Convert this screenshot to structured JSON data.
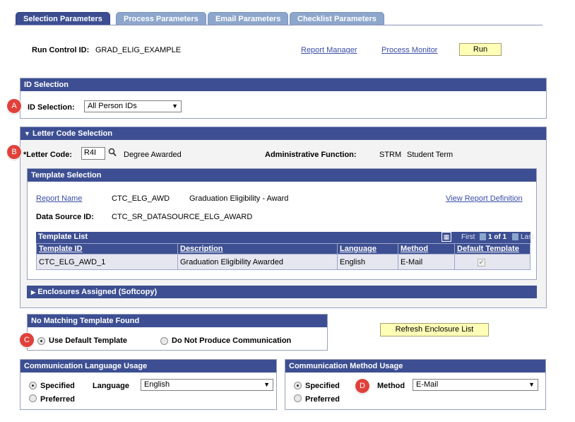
{
  "tabs": [
    {
      "label": "Selection Parameters",
      "active": true
    },
    {
      "label": "Process Parameters",
      "active": false
    },
    {
      "label": "Email Parameters",
      "active": false
    },
    {
      "label": "Checklist Parameters",
      "active": false
    }
  ],
  "header": {
    "run_control_label": "Run Control ID:",
    "run_control_value": "GRAD_ELIG_EXAMPLE",
    "report_manager": "Report Manager",
    "process_monitor": "Process Monitor",
    "run_button": "Run"
  },
  "id_selection": {
    "title": "ID Selection",
    "label": "ID Selection:",
    "value": "All Person IDs",
    "badge": "A"
  },
  "letter_code": {
    "title": "Letter Code Selection",
    "label": "*Letter Code:",
    "value": "R4I",
    "description": "Degree Awarded",
    "admin_func_label": "Administrative Function:",
    "admin_func_code": "STRM",
    "admin_func_desc": "Student Term",
    "badge": "B"
  },
  "template_selection": {
    "title": "Template Selection",
    "report_name_label": "Report Name",
    "report_name_code": "CTC_ELG_AWD",
    "report_name_desc": "Graduation Eligibility - Award",
    "view_report": "View Report Definition",
    "data_source_label": "Data Source ID:",
    "data_source_value": "CTC_SR_DATASOURCE_ELG_AWARD"
  },
  "template_list": {
    "title": "Template List",
    "nav_first": "First",
    "nav_range": "1 of 1",
    "nav_last": "Last",
    "columns": [
      "Template ID",
      "Description",
      "Language",
      "Method",
      "Default Template"
    ],
    "rows": [
      {
        "template_id": "CTC_ELG_AWD_1",
        "description": "Graduation Eligibility Awarded",
        "language": "English",
        "method": "E-Mail",
        "default": true
      }
    ]
  },
  "enclosures": {
    "title": "Enclosures Assigned (Softcopy)"
  },
  "no_match": {
    "title": "No Matching Template Found",
    "option_default": "Use Default Template",
    "option_none": "Do Not Produce Communication",
    "badge": "C"
  },
  "refresh_button": "Refresh Enclosure List",
  "comm_language": {
    "title": "Communication Language Usage",
    "specified": "Specified",
    "preferred": "Preferred",
    "language_label": "Language",
    "language_value": "English"
  },
  "comm_method": {
    "title": "Communication Method Usage",
    "specified": "Specified",
    "preferred": "Preferred",
    "method_label": "Method",
    "method_value": "E-Mail",
    "badge": "D"
  },
  "colors": {
    "header_blue": "#3d4f92",
    "tab_inactive": "#8da6cc",
    "button_yellow": "#ffffb7",
    "badge_red": "#e0413b",
    "link_blue": "#3a4ea8"
  }
}
